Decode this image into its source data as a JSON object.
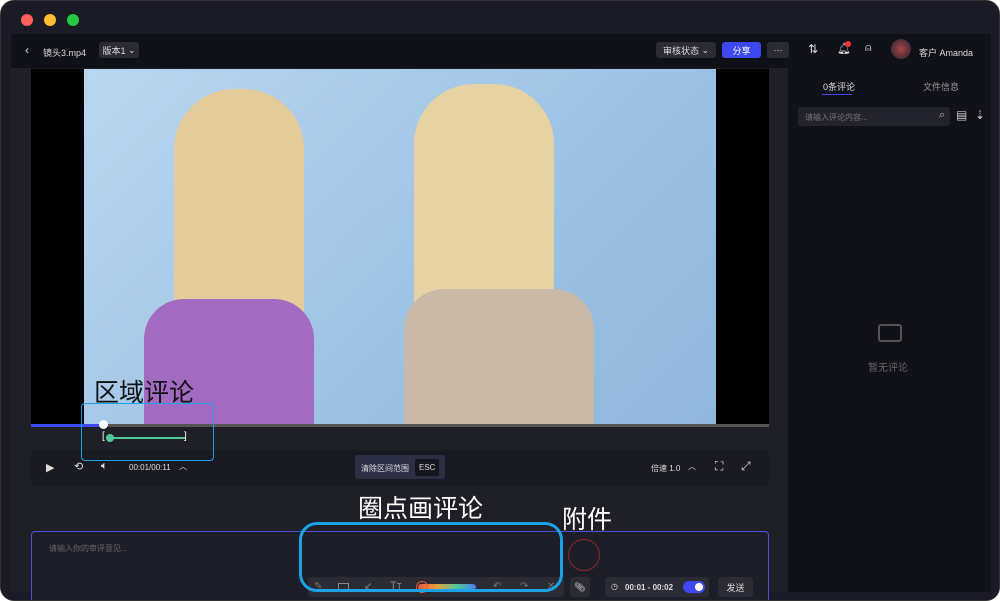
{
  "header": {
    "file_name": "镜头3.mp4",
    "version": "版本1",
    "review_status": "审核状态",
    "share": "分享",
    "more": "···",
    "user": "客户 Amanda"
  },
  "player": {
    "time": "00:01/00:11",
    "clear_range": "清除区间范围",
    "esc": "ESC",
    "speed": "倍速 1.0",
    "progress": 0.1
  },
  "comment_box": {
    "placeholder": "请输入你的审评意见...",
    "time_range": "00:01 - 00:02",
    "send": "发送",
    "colors": [
      "#e8583a",
      "#e8a23a",
      "#4fc89a",
      "#4a7cf0"
    ]
  },
  "sidebar": {
    "tabs": [
      "0条评论",
      "文件信息"
    ],
    "search_placeholder": "请输入评论内容...",
    "empty": "暂无评论"
  },
  "annotations": {
    "region": "区域评论",
    "draw": "圈点画评论",
    "attach": "附件"
  },
  "colors": {
    "accent": "#3e48f0",
    "callout": "#1aa3e8"
  }
}
